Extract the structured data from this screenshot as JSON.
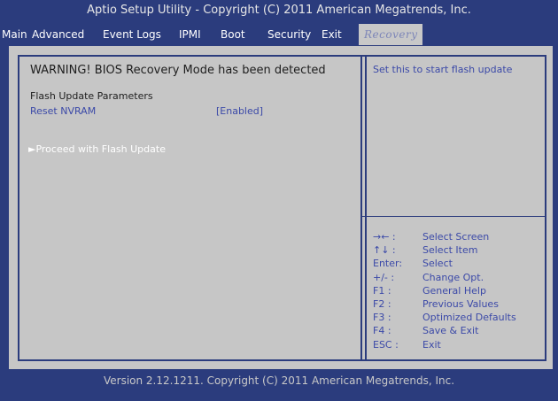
{
  "title": "Aptio Setup Utility - Copyright (C) 2011 American Megatrends, Inc.",
  "menu": {
    "tabs": [
      {
        "label": "Main"
      },
      {
        "label": "Advanced"
      },
      {
        "label": "Event Logs"
      },
      {
        "label": "IPMI"
      },
      {
        "label": "Boot"
      },
      {
        "label": "Security"
      },
      {
        "label": "Exit"
      },
      {
        "label": "Recovery"
      }
    ],
    "active": "Recovery"
  },
  "main": {
    "warning": "WARNING! BIOS Recovery Mode has been detected",
    "section_title": "Flash Update Parameters",
    "items": [
      {
        "label": "Reset NVRAM",
        "value": "[Enabled]"
      }
    ],
    "proceed": "►Proceed with Flash Update"
  },
  "help": {
    "text": "Set this to start flash update",
    "keys": [
      {
        "key": "→← :",
        "desc": "Select Screen"
      },
      {
        "key": "↑↓  :",
        "desc": "Select Item"
      },
      {
        "key": "Enter:",
        "desc": "Select"
      },
      {
        "key": "+/-  :",
        "desc": "Change Opt."
      },
      {
        "key": "F1 :",
        "desc": "General Help"
      },
      {
        "key": "F2 :",
        "desc": "Previous Values"
      },
      {
        "key": "F3 :",
        "desc": "Optimized Defaults"
      },
      {
        "key": "F4 :",
        "desc": "Save & Exit"
      },
      {
        "key": "ESC :",
        "desc": "Exit"
      }
    ]
  },
  "footer": "Version 2.12.1211. Copyright (C) 2011 American Megatrends, Inc.",
  "colors": {
    "background": "#2b3c7d",
    "panel": "#c6c6c6",
    "link_text": "#3b49a8",
    "highlight_text": "#ffffff"
  }
}
